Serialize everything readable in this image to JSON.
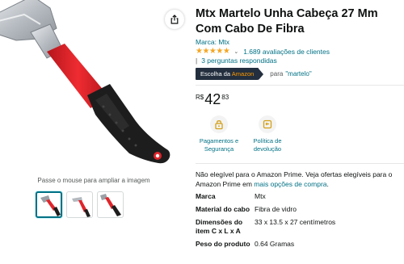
{
  "product": {
    "title": "Mtx Martelo Unha Cabeça 27 Mm Com Cabo De Fibra",
    "brand_label": "Marca: Mtx",
    "rating_stars": "★★★★★",
    "rating_value": 4.7,
    "ratings_count_text": "1.689 avaliações de clientes",
    "questions_text": "3 perguntas respondidas",
    "choice_badge": {
      "prefix": "Escolha da ",
      "brand": "Amazon"
    },
    "choice_for_label": "para",
    "choice_keyword": "\"martelo\"",
    "price": {
      "currency": "R$",
      "whole": "42",
      "cents": "83"
    }
  },
  "features": [
    {
      "label": "Pagamentos e Segurança",
      "icon": "lock-icon"
    },
    {
      "label": "Política de devolução",
      "icon": "return-icon"
    }
  ],
  "prime_notice": {
    "text": "Não elegível para o Amazon Prime. Veja ofertas elegíveis para o Amazon Prime em ",
    "link": "mais opções de compra",
    "end": "."
  },
  "specs": [
    {
      "key": "Marca",
      "value": "Mtx"
    },
    {
      "key": "Material do cabo",
      "value": "Fibra de vidro"
    },
    {
      "key": "Dimensões do item C x L x A",
      "value": "33 x 13.5 x 27 centímetros"
    },
    {
      "key": "Peso do produto",
      "value": "0.64 Gramas"
    }
  ],
  "gallery": {
    "hover_hint": "Passe o mouse para ampliar a imagem",
    "thumbnail_count": 3,
    "active_thumbnail": 1
  },
  "colors": {
    "link": "#007185",
    "star": "#f5a623",
    "badge_bg": "#232f3e",
    "badge_accent": "#ff9900",
    "handle_red": "#e0252b"
  }
}
